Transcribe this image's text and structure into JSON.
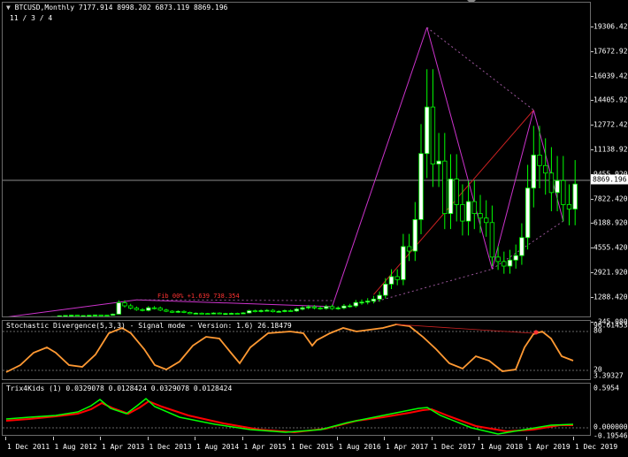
{
  "main": {
    "title_icon": "chart-symbol-icon",
    "title": "BTCUSD,Monthly  7177.914 8998.202 6873.119 8869.196",
    "subtitle": "11 / 3 / 4",
    "current_price": "8869.196",
    "annotation": "Fib 00% +1.639 738.354",
    "price_ticks": [
      "19306.420",
      "17672.920",
      "16039.420",
      "14405.920",
      "12772.420",
      "11138.920",
      "9455.920",
      "7822.420",
      "6188.920",
      "4555.420",
      "2921.920",
      "1288.420",
      "-345.080"
    ]
  },
  "stoch": {
    "title": "Stochastic Divergence(5,3,3) - Signal mode - Version: 1.6) 26.18479",
    "ticks": [
      "96.61453",
      "80",
      "20",
      "3.39327"
    ]
  },
  "trix": {
    "title": "Trix4Kids (1) 0.0329078 0.0128424 0.0329078 0.0128424",
    "ticks": [
      "0.5954",
      "0.0000000",
      "-0.1954658"
    ]
  },
  "time_axis": [
    "1 Dec 2011",
    "1 Aug 2012",
    "1 Apr 2013",
    "1 Dec 2013",
    "1 Aug 2014",
    "1 Apr 2015",
    "1 Dec 2015",
    "1 Aug 2016",
    "1 Apr 2017",
    "1 Dec 2017",
    "1 Aug 2018",
    "1 Apr 2019",
    "1 Dec 2019"
  ],
  "colors": {
    "up": "#00ff00",
    "up_body": "#ffffff",
    "down_body": "#000000",
    "zigzag": "#cc33cc",
    "stoch": "#ff9933",
    "trix_fast": "#00ff00",
    "trix_slow": "#ff0000"
  },
  "chart_data": [
    {
      "type": "candlestick",
      "title": "BTCUSD,Monthly",
      "ylim": [
        -345.08,
        19306.42
      ],
      "close_series": {
        "name": "BTCUSD",
        "values": [
          5,
          6,
          10,
          12,
          14,
          11,
          13,
          20,
          30,
          90,
          110,
          130,
          60,
          100,
          120,
          140,
          130,
          120,
          200,
          950,
          750,
          600,
          500,
          450,
          620,
          600,
          470,
          390,
          320,
          380,
          310,
          230,
          260,
          240,
          220,
          270,
          230,
          240,
          250,
          230,
          280,
          420,
          370,
          430,
          450,
          360,
          380,
          430,
          410,
          530,
          620,
          680,
          610,
          580,
          700,
          570,
          610,
          740,
          750,
          970,
          1000,
          1070,
          1200,
          1450,
          2200,
          2700,
          2500,
          4700,
          4400,
          6500,
          10900,
          14000,
          10200,
          10400,
          6900,
          9200,
          7500,
          6400,
          7700,
          6900,
          6600,
          6300,
          4000,
          3700,
          3400,
          3800,
          4100,
          5300,
          8600,
          10800,
          10100,
          9600,
          8300,
          9100,
          7500,
          7200,
          8869
        ]
      }
    },
    {
      "type": "line",
      "title": "Stochastic Divergence(5,3,3)",
      "ylim": [
        3.39327,
        96.61453
      ]
    },
    {
      "type": "line",
      "title": "Trix4Kids (1)",
      "ylim": [
        -0.1954658,
        0.5954
      ]
    }
  ]
}
